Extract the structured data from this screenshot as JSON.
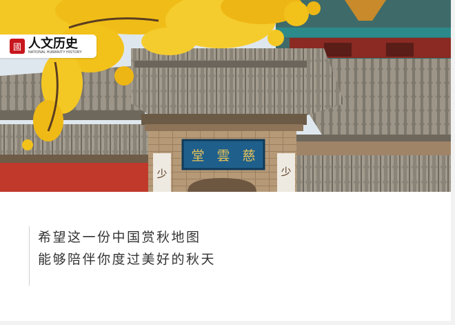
{
  "logo": {
    "seal": "國",
    "name_cn": "人文历史",
    "name_en": "NATIONAL HUMANITY HISTORY"
  },
  "plaque": {
    "characters": [
      "堂",
      "雲",
      "慈"
    ],
    "pillar_left": "少",
    "pillar_right": "少"
  },
  "caption": {
    "line1": "希望这一份中国赏秋地图",
    "line2": "能够陪伴你度过美好的秋天"
  },
  "colors": {
    "ginkgo_yellow": "#f2c21b",
    "roof_tile_gray": "#8d8679",
    "wall_red": "#c0392b",
    "plaque_blue": "#1f5f8b",
    "plaque_gold": "#e8c35a",
    "sky": "#dfe7ee"
  }
}
